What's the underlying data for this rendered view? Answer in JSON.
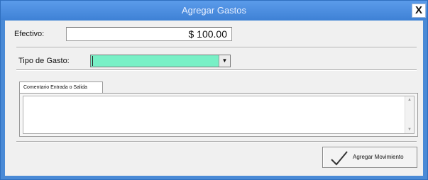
{
  "window": {
    "title": "Agregar Gastos",
    "close_label": "X"
  },
  "efectivo": {
    "label": "Efectivo:",
    "value": "$ 100.00"
  },
  "tipo_gasto": {
    "label": "Tipo de Gasto:",
    "selected": "",
    "highlight_color": "#78f0c6"
  },
  "comentario": {
    "tab_label": "Comentario Entrada o Salida",
    "value": ""
  },
  "actions": {
    "add_label": "Agregar Movimiento"
  },
  "icons": {
    "close": "close-icon",
    "dropdown": "chevron-down-icon",
    "check": "checkmark-icon"
  }
}
